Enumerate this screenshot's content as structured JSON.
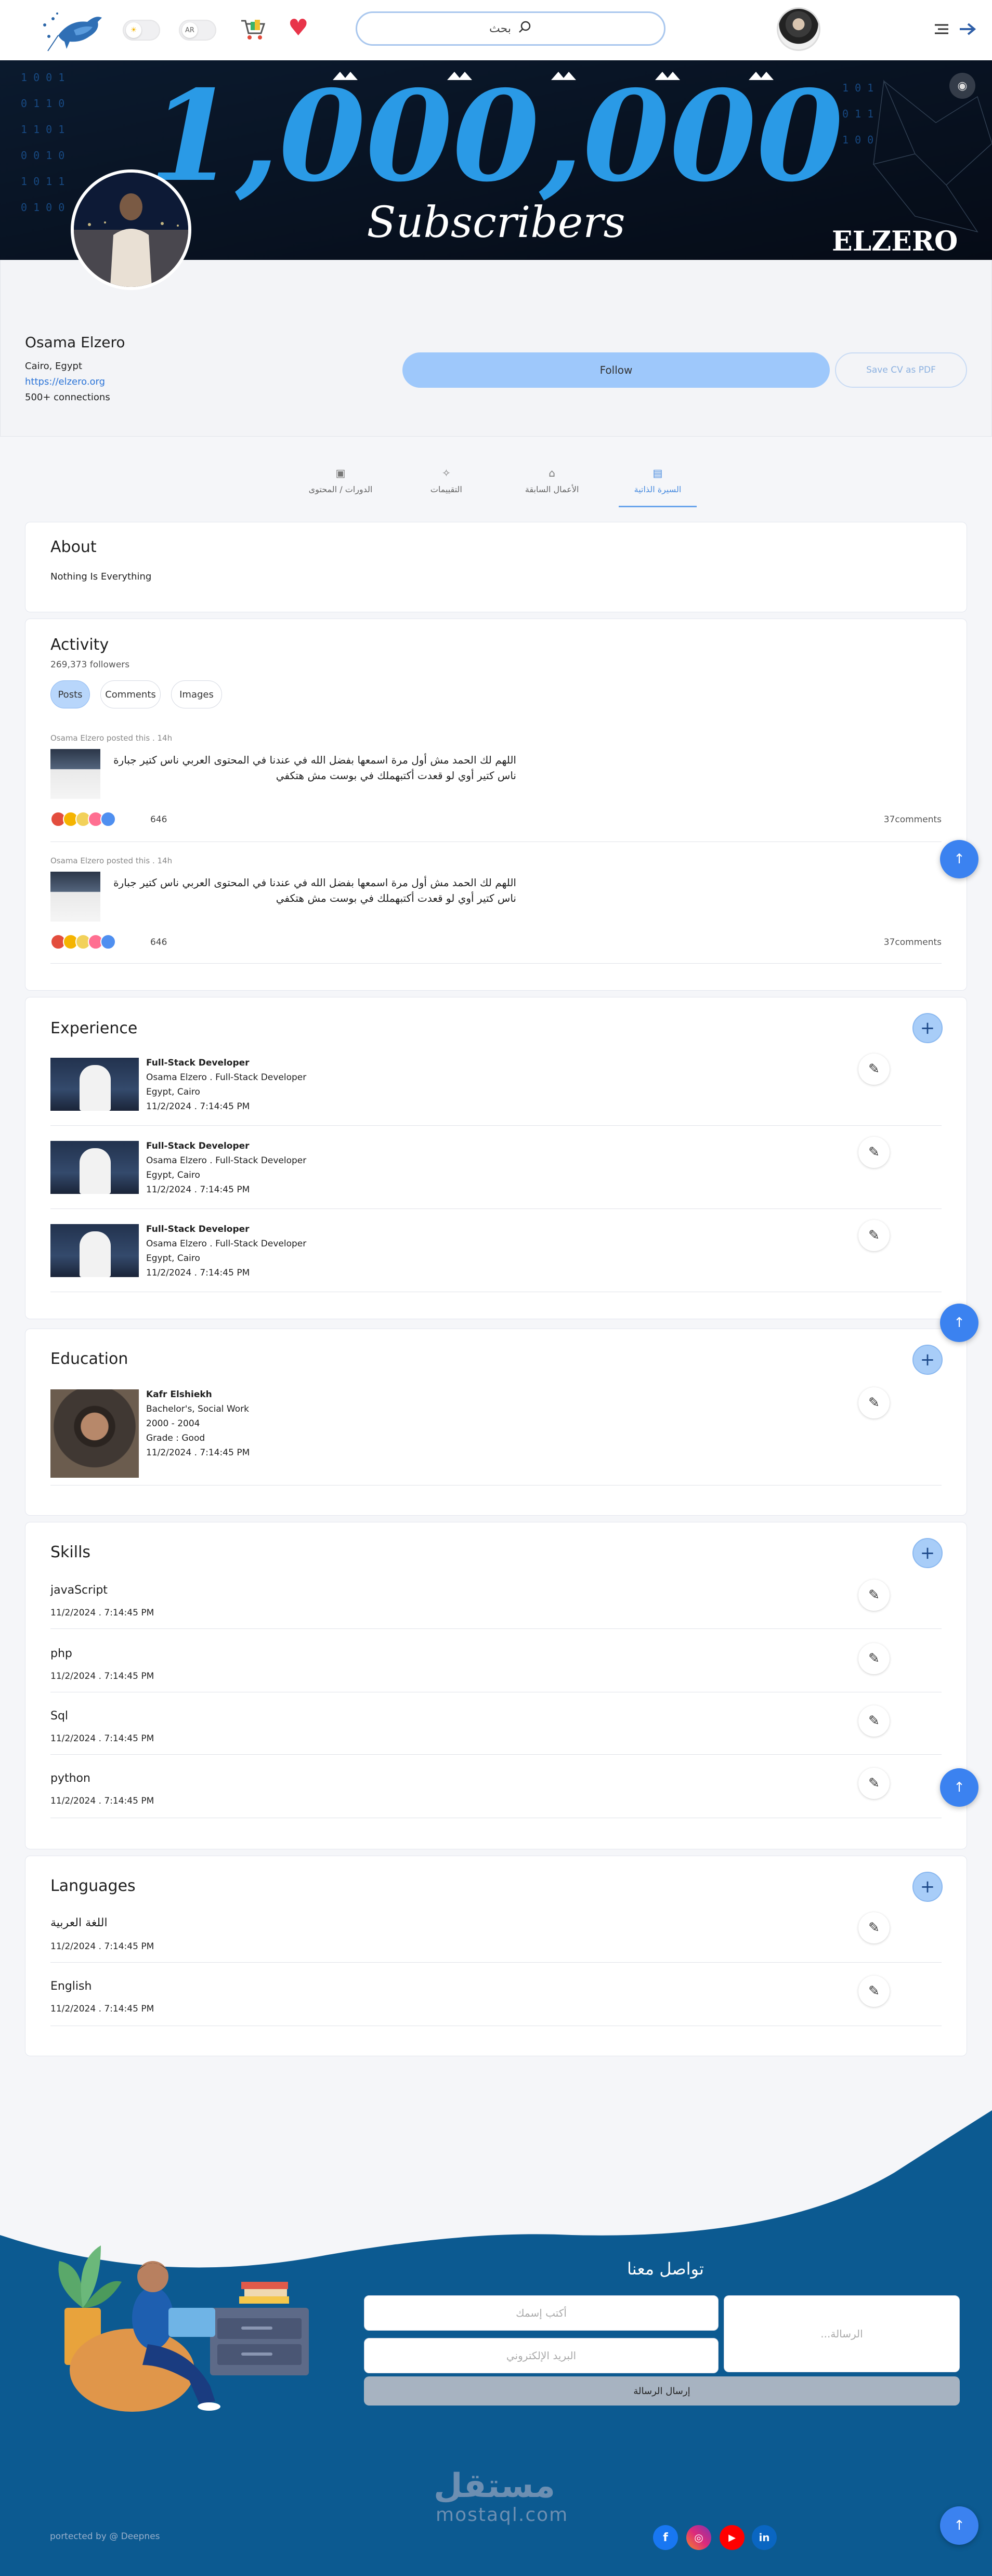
{
  "header": {
    "lang_toggle": "AR",
    "search_label": "بحث",
    "colors": {
      "accent": "#3b82f0",
      "heart": "#e8354a"
    }
  },
  "cover": {
    "big_number": "1,000,000",
    "subtitle": "Subscribers",
    "brand": "ELZERO"
  },
  "profile": {
    "name": "Osama Elzero",
    "location": "Cairo, Egypt",
    "website": "https://elzero.org",
    "connections": "500+ connections",
    "follow_label": "Follow",
    "save_cv_label": "Save CV as PDF"
  },
  "tabs": [
    {
      "label": "السيرة الذاتية",
      "icon": "document-icon",
      "active": true
    },
    {
      "label": "الأعمال السابقة",
      "icon": "briefcase-icon",
      "active": false
    },
    {
      "label": "التقييمات",
      "icon": "sparkle-icon",
      "active": false
    },
    {
      "label": "الدورات / المحتوى",
      "icon": "image-icon",
      "active": false
    }
  ],
  "about": {
    "title": "About",
    "text": "Nothing Is Everything"
  },
  "activity": {
    "title": "Activity",
    "followers": "269,373 followers",
    "filters": [
      "Posts",
      "Comments",
      "Images"
    ],
    "posts": [
      {
        "meta": "Osama Elzero posted this . 14h",
        "text": "اللهم لك الحمد مش أول مرة اسمعها بفضل الله في عندنا في المحتوى العربي ناس كتير جبارة ناس كتير أوي لو قعدت أكتبهملك في بوست مش هتكفي",
        "reactions": "646",
        "comments": "37comments"
      },
      {
        "meta": "Osama Elzero posted this . 14h",
        "text": "اللهم لك الحمد مش أول مرة اسمعها بفضل الله في عندنا في المحتوى العربي ناس كتير جبارة ناس كتير أوي لو قعدت أكتبهملك في بوست مش هتكفي",
        "reactions": "646",
        "comments": "37comments"
      }
    ]
  },
  "experience": {
    "title": "Experience",
    "items": [
      {
        "role": "Full-Stack Developer",
        "company": "Osama Elzero . Full-Stack Developer",
        "location": "Egypt, Cairo",
        "date": "11/2/2024 . 7:14:45 PM"
      },
      {
        "role": "Full-Stack Developer",
        "company": "Osama Elzero . Full-Stack Developer",
        "location": "Egypt, Cairo",
        "date": "11/2/2024 . 7:14:45 PM"
      },
      {
        "role": "Full-Stack Developer",
        "company": "Osama Elzero . Full-Stack Developer",
        "location": "Egypt, Cairo",
        "date": "11/2/2024 . 7:14:45 PM"
      }
    ]
  },
  "education": {
    "title": "Education",
    "items": [
      {
        "school": "Kafr Elshiekh",
        "degree": "Bachelor's, Social Work",
        "years": "2000 - 2004",
        "grade": "Grade : Good",
        "date": "11/2/2024 . 7:14:45 PM"
      }
    ]
  },
  "skills": {
    "title": "Skills",
    "items": [
      {
        "name": "javaScript",
        "date": "11/2/2024 . 7:14:45 PM"
      },
      {
        "name": "php",
        "date": "11/2/2024 . 7:14:45 PM"
      },
      {
        "name": "Sql",
        "date": "11/2/2024 . 7:14:45 PM"
      },
      {
        "name": "python",
        "date": "11/2/2024 . 7:14:45 PM"
      }
    ]
  },
  "languages": {
    "title": "Languages",
    "items": [
      {
        "name": "اللغة العربية",
        "date": "11/2/2024 . 7:14:45 PM"
      },
      {
        "name": "English",
        "date": "11/2/2024 . 7:14:45 PM"
      }
    ]
  },
  "footer": {
    "contact_title": "تواصل معنا",
    "name_placeholder": "أكتب إسمك",
    "email_placeholder": "البريد الإلكتروني",
    "message_placeholder": "الرسالة...",
    "send_label": "إرسال الرسالة",
    "watermark_ar": "مستقل",
    "watermark_en": "mostaql.com",
    "credit": "portected by @ Deepnes",
    "social": [
      "facebook-icon",
      "instagram-icon",
      "youtube-icon",
      "linkedin-icon"
    ],
    "colors": {
      "wave": "#0c5a91"
    }
  }
}
